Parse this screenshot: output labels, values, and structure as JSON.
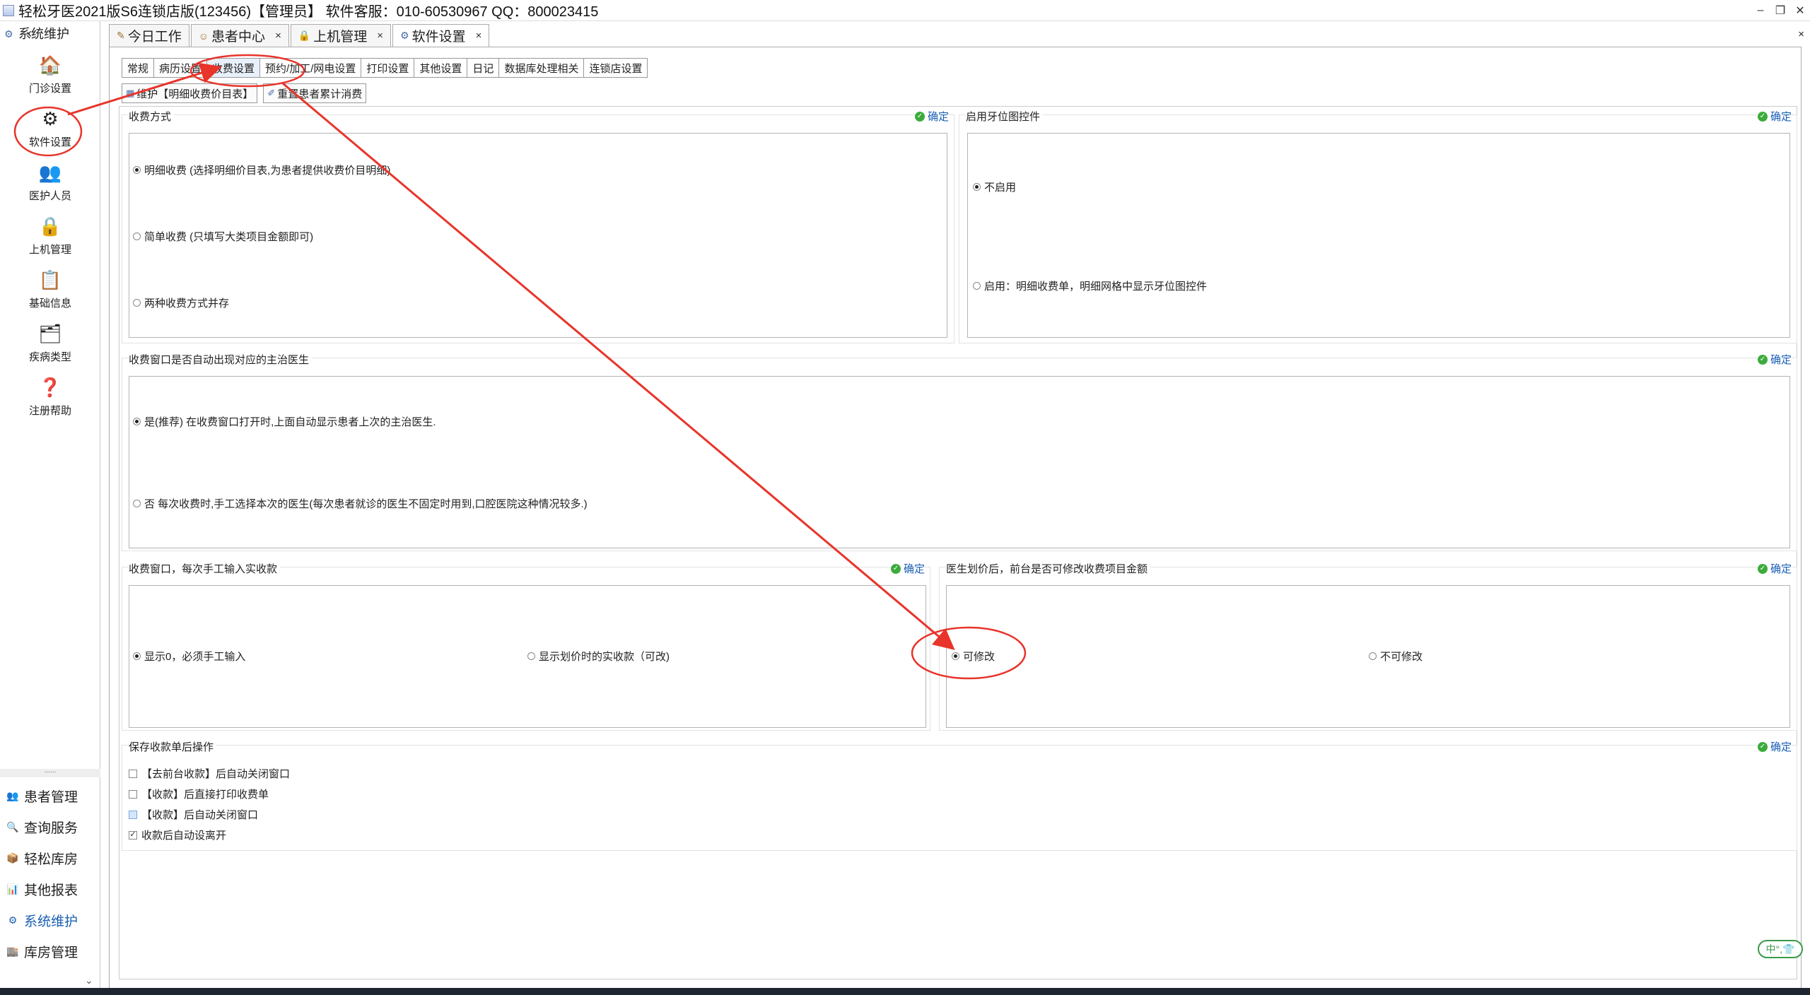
{
  "window": {
    "title": "轻松牙医2021版S6连锁店版(123456)【管理员】   软件客服：010-60530967 QQ：800023415",
    "min": "–",
    "restore": "❐",
    "close": "✕"
  },
  "leftnav": {
    "header": "系统维护",
    "collapse": "‹",
    "items": [
      {
        "label": "门诊设置",
        "icon": "🏠"
      },
      {
        "label": "软件设置",
        "icon": "⚙"
      },
      {
        "label": "医护人员",
        "icon": "👥"
      },
      {
        "label": "上机管理",
        "icon": "🔒"
      },
      {
        "label": "基础信息",
        "icon": "📋"
      },
      {
        "label": "疾病类型",
        "icon": "🗂"
      },
      {
        "label": "注册帮助",
        "icon": "❓"
      }
    ],
    "splitter": "......",
    "bottom": [
      {
        "label": "患者管理",
        "icon": "👥"
      },
      {
        "label": "查询服务",
        "icon": "🔍"
      },
      {
        "label": "轻松库房",
        "icon": "📦"
      },
      {
        "label": "其他报表",
        "icon": "📊"
      },
      {
        "label": "系统维护",
        "icon": "⚙"
      },
      {
        "label": "库房管理",
        "icon": "🏬"
      }
    ],
    "down": "⌄"
  },
  "toptabs": [
    {
      "label": "今日工作",
      "closable": false
    },
    {
      "label": "患者中心",
      "closable": true
    },
    {
      "label": "上机管理",
      "closable": true
    },
    {
      "label": "软件设置",
      "closable": true
    }
  ],
  "tabclose": "×",
  "subtabs": [
    "常规",
    "病历设置",
    "收费设置",
    "预约/加工/网电设置",
    "打印设置",
    "其他设置",
    "日记",
    "数据库处理相关",
    "连锁店设置"
  ],
  "toolbar": {
    "maintain": "维护【明细收费价目表】",
    "reset": "重置患者累计消费"
  },
  "ok_label": "确定",
  "groups": {
    "pay_method": {
      "title": "收费方式",
      "options": [
        "明细收费 (选择明细价目表,为患者提供收费价目明细)",
        "简单收费 (只填写大类项目金额即可)",
        "两种收费方式并存"
      ],
      "selected": 0
    },
    "tooth_chart": {
      "title": "启用牙位图控件",
      "options": [
        "不启用",
        "启用：明细收费单，明细网格中显示牙位图控件"
      ],
      "selected": 0
    },
    "doctor": {
      "title": "收费窗口是否自动出现对应的主治医生",
      "options": [
        "是(推荐)    在收费窗口打开时,上面自动显示患者上次的主治医生.",
        "否     每次收费时,手工选择本次的医生(每次患者就诊的医生不固定时用到,口腔医院这种情况较多.)"
      ],
      "selected": 0
    },
    "manual_input": {
      "title": "收费窗口，每次手工输入实收款",
      "options": [
        "显示0，必须手工输入",
        "显示划价时的实收款（可改)"
      ],
      "selected": 0
    },
    "modify_amount": {
      "title": "医生划价后，前台是否可修改收费项目金额",
      "options": [
        "可修改",
        "不可修改"
      ],
      "selected": 0
    },
    "after_save": {
      "title": "保存收款单后操作",
      "checks": [
        {
          "label": "【去前台收款】后自动关闭窗口",
          "checked": false
        },
        {
          "label": "【收款】后直接打印收费单",
          "checked": false
        },
        {
          "label": "【收款】后自动关闭窗口",
          "checked": false
        },
        {
          "label": "收款后自动设离开",
          "checked": true
        }
      ]
    }
  },
  "ime": "中°,👕",
  "annotation_color": "#e8342a"
}
